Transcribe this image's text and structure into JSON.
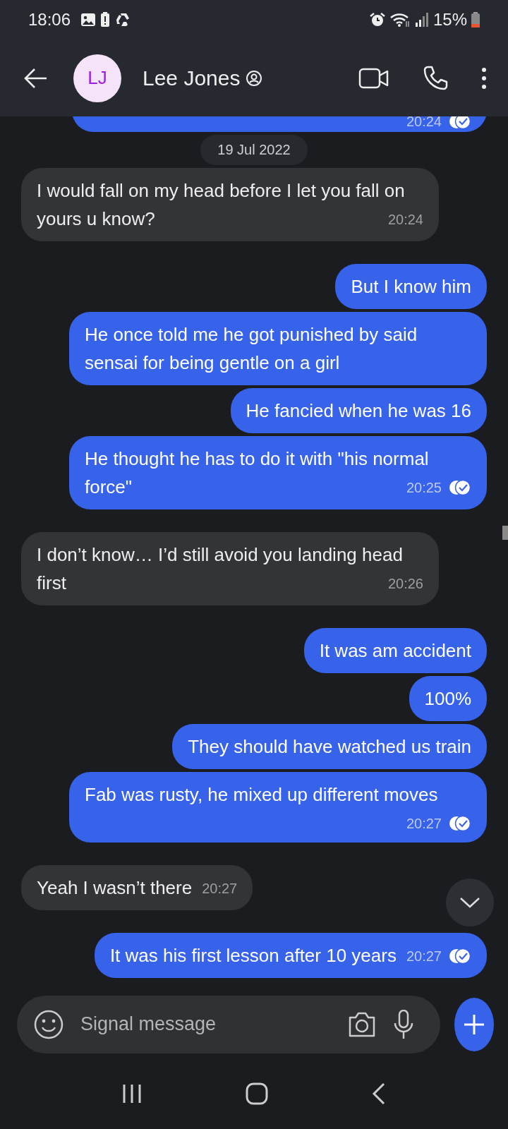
{
  "status_bar": {
    "time": "18:06",
    "battery": "15%"
  },
  "header": {
    "avatar_initials": "LJ",
    "contact_name": "Lee Jones"
  },
  "date_divider": "19 Jul 2022",
  "messages": [
    {
      "kind": "outgoing",
      "time": "20:24",
      "read": true
    },
    {
      "kind": "incoming",
      "text": "I would fall on my head before I let you fall on yours u know?",
      "time": "20:24"
    },
    {
      "kind": "outgoing",
      "text": "But I know him"
    },
    {
      "kind": "outgoing",
      "text": "He once told me he got punished by said sensai for being gentle on a girl"
    },
    {
      "kind": "outgoing",
      "text": "He fancied when he was 16"
    },
    {
      "kind": "outgoing",
      "text": "He thought he has to do it with \"his normal force\"",
      "time": "20:25",
      "read": true
    },
    {
      "kind": "incoming",
      "text": "I don’t know… I’d still avoid you landing head first",
      "time": "20:26"
    },
    {
      "kind": "outgoing",
      "text": "It was am accident"
    },
    {
      "kind": "outgoing",
      "text": "100%"
    },
    {
      "kind": "outgoing",
      "text": "They should have watched us train"
    },
    {
      "kind": "outgoing",
      "text": "Fab was rusty, he mixed up different moves",
      "time": "20:27",
      "read": true
    },
    {
      "kind": "incoming",
      "text": "Yeah I wasn’t there",
      "time": "20:27"
    },
    {
      "kind": "outgoing",
      "text": "It was his first lesson after 10 years",
      "time": "20:27",
      "read": true
    }
  ],
  "composer": {
    "placeholder": "Signal message"
  }
}
